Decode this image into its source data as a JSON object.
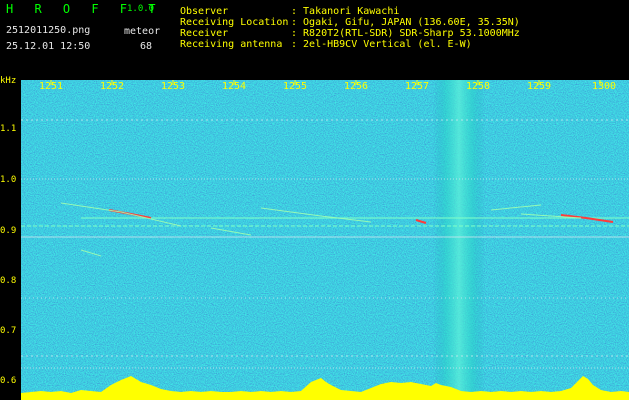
{
  "header": {
    "app_name": "H R O F F T",
    "version": "1.0.0",
    "filename": "2512011250.png",
    "datetime": "25.12.01 12:50",
    "meteor_label": "meteor",
    "meteor_count": "68",
    "info_labels": [
      "Observer",
      "Receiving Location",
      "Receiver",
      "Receiving antenna"
    ],
    "info_values": [
      ": Takanori Kawachi",
      ": Ogaki, Gifu, JAPAN (136.60E, 35.35N)",
      ": R820T2(RTL-SDR) SDR-Sharp 53.1000MHz",
      ": 2el-HB9CV Vertical (el. E-W)"
    ]
  },
  "axes": {
    "y_unit": "kHz",
    "y_ticks": [
      "1.1",
      "1.0",
      "0.9",
      "0.8",
      "0.7",
      "0.6"
    ],
    "x_ticks": [
      "1251",
      "1252",
      "1253",
      "1254",
      "1255",
      "1256",
      "1257",
      "1258",
      "1259",
      "1300"
    ]
  },
  "colors": {
    "background": "#000000",
    "spectrum": "#0b2aa8",
    "label": "#ffff00",
    "title": "#00ff00",
    "text": "#e8e8e8",
    "signal": "#ffff00"
  }
}
